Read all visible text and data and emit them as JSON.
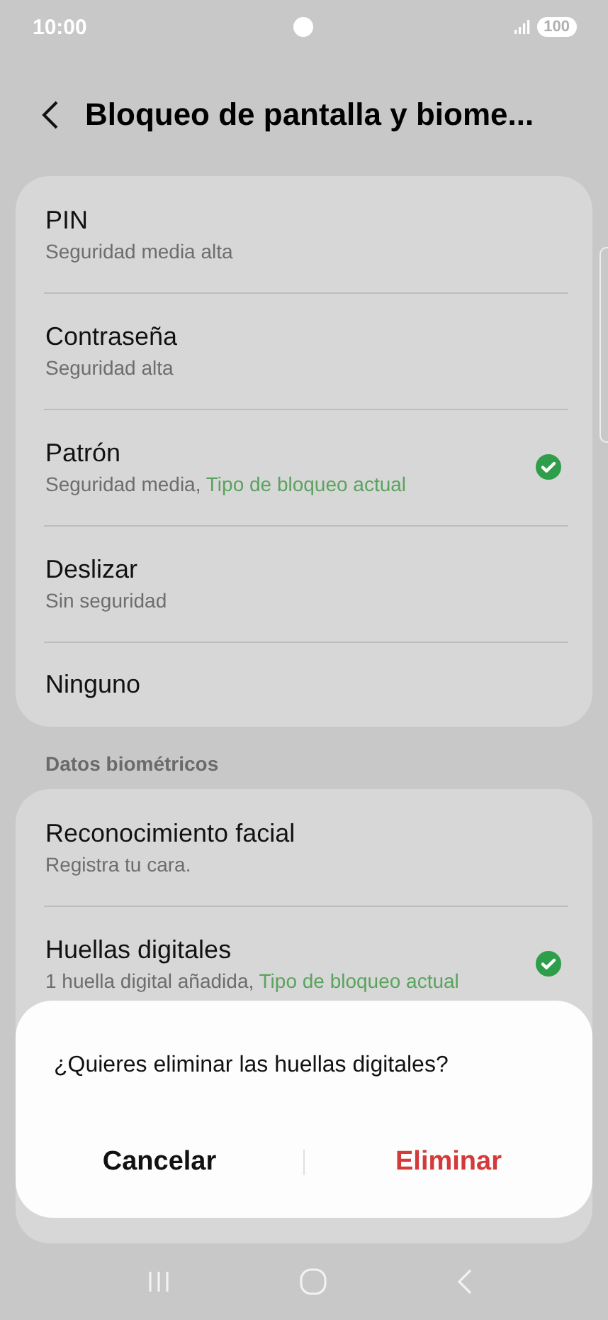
{
  "status_bar": {
    "time": "10:00",
    "battery": "100"
  },
  "header": {
    "title": "Bloqueo de pantalla y biome..."
  },
  "lock_types": [
    {
      "title": "PIN",
      "subtitle": "Seguridad media alta",
      "checked": false
    },
    {
      "title": "Contraseña",
      "subtitle": "Seguridad alta",
      "checked": false
    },
    {
      "title": "Patrón",
      "subtitle": "Seguridad media,",
      "status": "Tipo de bloqueo actual",
      "checked": true
    },
    {
      "title": "Deslizar",
      "subtitle": "Sin seguridad",
      "checked": false
    },
    {
      "title": "Ninguno",
      "checked": false
    }
  ],
  "biometrics": {
    "heading": "Datos biométricos",
    "items": [
      {
        "title": "Reconocimiento facial",
        "subtitle": "Registra tu cara.",
        "checked": false
      },
      {
        "title": "Huellas digitales",
        "subtitle": "1 huella digital añadida,",
        "status": "Tipo de bloqueo actual",
        "checked": true
      }
    ]
  },
  "dialog": {
    "message": "¿Quieres eliminar las huellas digitales?",
    "buttons": [
      {
        "label": "Cancelar",
        "kind": "neutral"
      },
      {
        "label": "Eliminar",
        "kind": "destructive"
      }
    ]
  }
}
